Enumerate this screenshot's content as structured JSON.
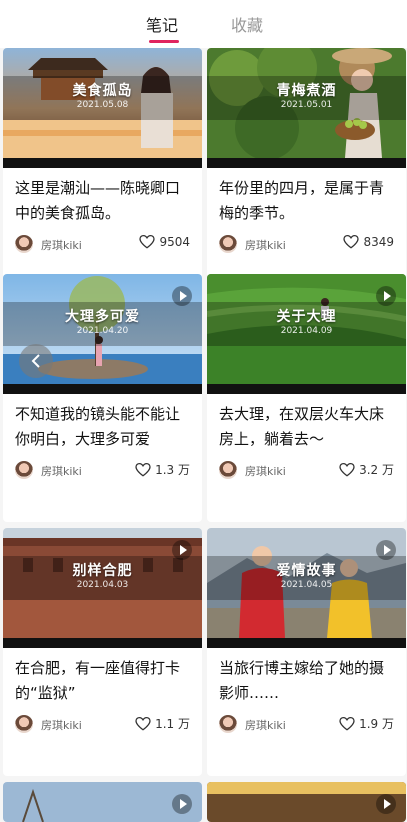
{
  "tabs": {
    "notes": "笔记",
    "favorites": "收藏",
    "active": "notes"
  },
  "cards": [
    {
      "overlay_title": "美食孤岛",
      "overlay_date": "2021.05.08",
      "title": "这里是潮汕——陈晓卿口中的美食孤岛。",
      "author": "房琪kiki",
      "likes": "9504",
      "video": false
    },
    {
      "overlay_title": "青梅煮酒",
      "overlay_date": "2021.05.01",
      "title": "年份里的四月，是属于青梅的季节。",
      "author": "房琪kiki",
      "likes": "8349",
      "video": false
    },
    {
      "overlay_title": "大理多可爱",
      "overlay_date": "2021.04.20",
      "title": "不知道我的镜头能不能让你明白，大理多可爱",
      "author": "房琪kiki",
      "likes": "1.3 万",
      "video": true
    },
    {
      "overlay_title": "关于大理",
      "overlay_date": "2021.04.09",
      "title": "去大理，在双层火车大床房上，躺着去～",
      "author": "房琪kiki",
      "likes": "3.2 万",
      "video": true
    },
    {
      "overlay_title": "别样合肥",
      "overlay_date": "2021.04.03",
      "title": "在合肥，有一座值得打卡的“监狱”",
      "author": "房琪kiki",
      "likes": "1.1 万",
      "video": true
    },
    {
      "overlay_title": "爱情故事",
      "overlay_date": "2021.04.05",
      "title": "当旅行博主嫁给了她的摄影师……",
      "author": "房琪kiki",
      "likes": "1.9 万",
      "video": true
    },
    {
      "video": true
    },
    {
      "video": true
    }
  ],
  "colors": {
    "accent": "#e0245e",
    "background": "#f5f5f5"
  },
  "icons": {
    "like": "heart-icon",
    "play": "play-icon",
    "back": "chevron-left-icon"
  }
}
